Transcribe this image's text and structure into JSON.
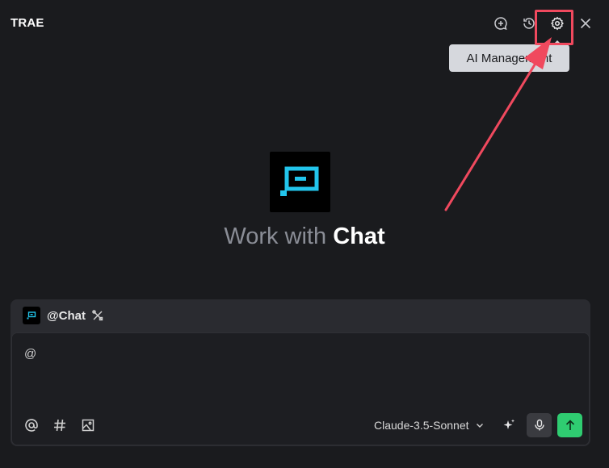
{
  "header": {
    "app_title": "TRAE",
    "tooltip": "AI Management",
    "icons": [
      "new-chat-icon",
      "history-icon",
      "settings-icon",
      "close-icon"
    ]
  },
  "hero": {
    "title_prefix": "Work with",
    "title_emphasis": "Chat"
  },
  "composer": {
    "agent_label": "@Chat",
    "input_value": "@",
    "model_name": "Claude-3.5-Sonnet",
    "toolbar_icons": [
      "at-icon",
      "hash-icon",
      "image-icon"
    ]
  },
  "colors": {
    "background": "#1a1b1e",
    "accent_cyan": "#22c5ec",
    "send_green": "#2fcc71",
    "annotation_red": "#f0495e"
  }
}
